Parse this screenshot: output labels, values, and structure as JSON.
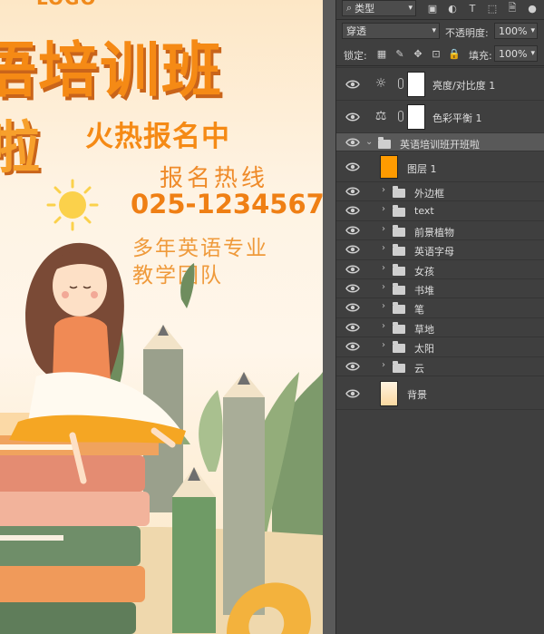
{
  "poster": {
    "logo": "LOGO",
    "headline_line1": "语培训班",
    "headline_line2": "啦",
    "tagline": "火热报名中",
    "hotline_label": "报名热线",
    "hotline_number": "025-1234567",
    "slogan_line1": "多年英语专业",
    "slogan_line2": "教学团队",
    "colors": {
      "primary_orange": "#f58a15",
      "shadow": "#c9641a",
      "background": "#fef3e3"
    }
  },
  "layers_panel": {
    "filter_kind": "类型",
    "blend_mode": "穿透",
    "opacity_label": "不透明度:",
    "opacity_value": "100%",
    "lock_label": "锁定:",
    "fill_label": "填充:",
    "fill_value": "100%",
    "layers": [
      {
        "name": "亮度/对比度 1",
        "type": "adjustment",
        "icon": "brightness-contrast-icon"
      },
      {
        "name": "色彩平衡 1",
        "type": "adjustment",
        "icon": "color-balance-icon"
      },
      {
        "name": "英语培训班开班啦",
        "type": "group-open"
      },
      {
        "name": "图层 1",
        "type": "pixel",
        "thumb_color": "#ff9b00"
      },
      {
        "name": "外边框",
        "type": "group"
      },
      {
        "name": "text",
        "type": "group"
      },
      {
        "name": "前景植物",
        "type": "group"
      },
      {
        "name": "英语字母",
        "type": "group"
      },
      {
        "name": "女孩",
        "type": "group"
      },
      {
        "name": "书堆",
        "type": "group"
      },
      {
        "name": "笔",
        "type": "group"
      },
      {
        "name": "草地",
        "type": "group"
      },
      {
        "name": "太阳",
        "type": "group"
      },
      {
        "name": "云",
        "type": "group"
      },
      {
        "name": "背景",
        "type": "pixel",
        "thumb_color": "#fde6bd"
      }
    ]
  }
}
